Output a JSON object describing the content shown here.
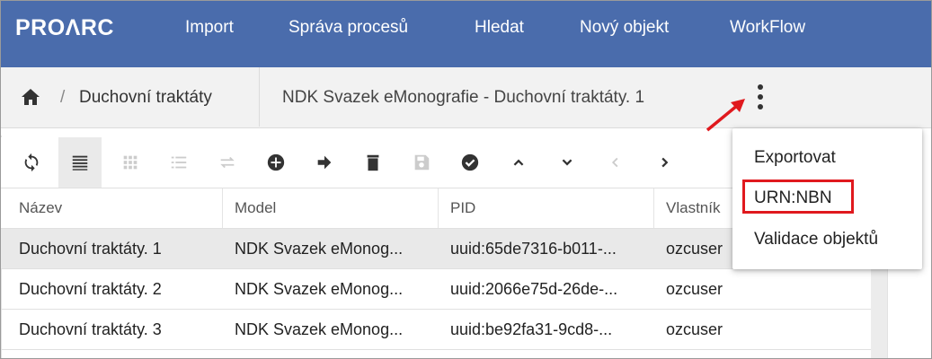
{
  "app": {
    "logo": "PROΛRC"
  },
  "nav": {
    "items": [
      "Import",
      "Správa procesů",
      "Hledat",
      "Nový objekt",
      "WorkFlow"
    ]
  },
  "breadcrumb": {
    "parent": "Duchovní traktáty",
    "separator": "/",
    "current": "NDK Svazek eMonografie - Duchovní traktáty. 1"
  },
  "toolbar": {
    "buttons": [
      "refresh-icon",
      "list-view-icon",
      "grid-view-icon",
      "numbered-list-icon",
      "swap-icon",
      "add-icon",
      "forward-arrow-icon",
      "delete-icon",
      "save-icon",
      "check-circle-icon",
      "chevron-up-icon",
      "chevron-down-icon",
      "chevron-left-icon",
      "chevron-right-icon"
    ]
  },
  "table": {
    "columns": [
      "Název",
      "Model",
      "PID",
      "Vlastník"
    ],
    "rows": [
      {
        "name": "Duchovní traktáty. 1",
        "model": "NDK Svazek eMonog...",
        "pid": "uuid:65de7316-b011-...",
        "owner": "ozcuser"
      },
      {
        "name": "Duchovní traktáty. 2",
        "model": "NDK Svazek eMonog...",
        "pid": "uuid:2066e75d-26de-...",
        "owner": "ozcuser"
      },
      {
        "name": "Duchovní traktáty. 3",
        "model": "NDK Svazek eMonog...",
        "pid": "uuid:be92fa31-9cd8-...",
        "owner": "ozcuser"
      }
    ]
  },
  "menu": {
    "items": [
      "Exportovat",
      "URN:NBN",
      "Validace objektů"
    ],
    "highlighted": "URN:NBN"
  },
  "colors": {
    "appbar": "#4a6cac",
    "highlight": "#e0191e",
    "selected_row": "#e9e9e9"
  }
}
